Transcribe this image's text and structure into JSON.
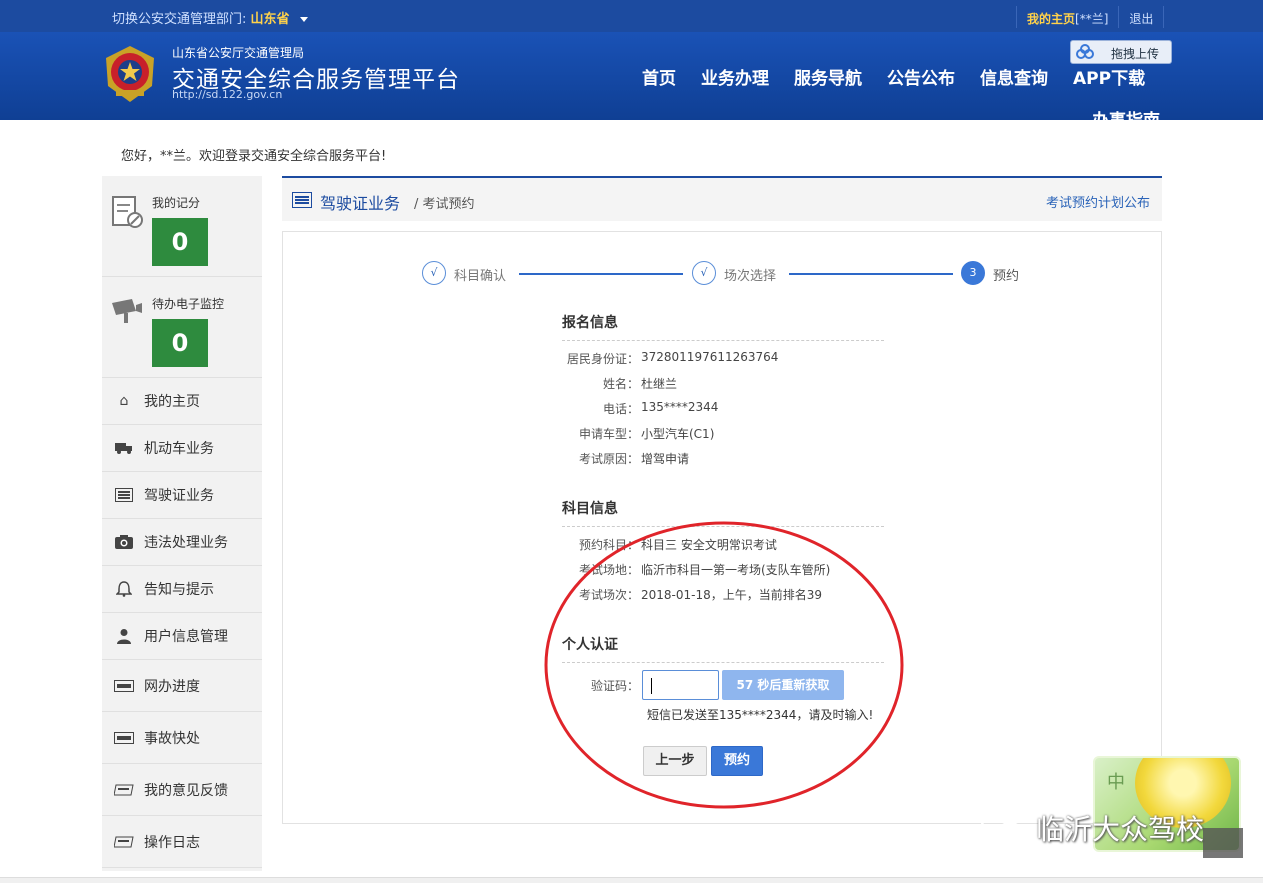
{
  "topbar": {
    "switch_label": "切换公安交通管理部门:",
    "province": "山东省",
    "my_home": "我的主页",
    "user_tag": "[**兰]",
    "logout": "退出"
  },
  "header": {
    "org": "山东省公安厅交通管理局",
    "title": "交通安全综合服务管理平台",
    "url": "http://sd.122.gov.cn",
    "upload_label": "拖拽上传",
    "nav": [
      "首页",
      "业务办理",
      "服务导航",
      "公告公布",
      "信息查询",
      "APP下载"
    ],
    "nav_extra": "办事指南"
  },
  "welcome": "您好，**兰。欢迎登录交通安全综合服务平台!",
  "sidebar": {
    "score_label": "我的记分",
    "score_value": "0",
    "monitor_label": "待办电子监控",
    "monitor_value": "0",
    "items": [
      {
        "label": "我的主页",
        "icon": "home-icon"
      },
      {
        "label": "机动车业务",
        "icon": "truck-icon"
      },
      {
        "label": "驾驶证业务",
        "icon": "list-icon"
      },
      {
        "label": "违法处理业务",
        "icon": "camera-icon"
      },
      {
        "label": "告知与提示",
        "icon": "bell-icon"
      },
      {
        "label": "用户信息管理",
        "icon": "user-icon"
      },
      {
        "label": "网办进度",
        "icon": "progress-icon"
      },
      {
        "label": "事故快处",
        "icon": "accident-icon"
      },
      {
        "label": "我的意见反馈",
        "icon": "feedback-icon"
      },
      {
        "label": "操作日志",
        "icon": "log-icon"
      }
    ]
  },
  "breadcrumb": {
    "main": "驾驶证业务",
    "sub": "/ 考试预约",
    "link": "考试预约计划公布"
  },
  "steps": [
    {
      "mark": "√",
      "label": "科目确认",
      "state": "done"
    },
    {
      "mark": "√",
      "label": "场次选择",
      "state": "done"
    },
    {
      "mark": "3",
      "label": "预约",
      "state": "active"
    }
  ],
  "registration": {
    "title": "报名信息",
    "rows": [
      {
        "k": "居民身份证：",
        "v": "372801197611263764"
      },
      {
        "k": "姓名：",
        "v": "杜继兰"
      },
      {
        "k": "电话：",
        "v": "135****2344"
      },
      {
        "k": "申请车型：",
        "v": "小型汽车(C1)"
      },
      {
        "k": "考试原因：",
        "v": "增驾申请"
      }
    ]
  },
  "subject": {
    "title": "科目信息",
    "rows": [
      {
        "k": "预约科目：",
        "v": "科目三 安全文明常识考试"
      },
      {
        "k": "考试场地：",
        "v": "临沂市科目一第一考场(支队车管所)"
      },
      {
        "k": "考试场次：",
        "v": "2018-01-18，上午，当前排名39"
      }
    ]
  },
  "auth": {
    "title": "个人认证",
    "code_label": "验证码：",
    "code_value": "",
    "resend": "57 秒后重新获取",
    "hint": "短信已发送至135****2344，请及时输入!"
  },
  "buttons": {
    "prev": "上一步",
    "submit": "预约"
  },
  "watermark": {
    "text": "临沂大众驾校",
    "badge": "中"
  }
}
